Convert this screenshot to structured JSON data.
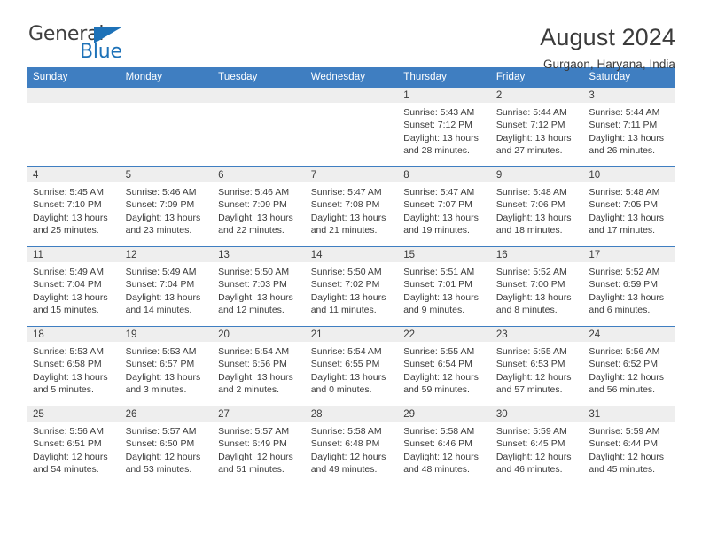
{
  "logo": {
    "word_one": "General",
    "word_two": "Blue",
    "triangle_icon": "triangle-icon",
    "accent_color": "#1e72b8"
  },
  "header": {
    "title": "August 2024",
    "subtitle": "Gurgaon, Haryana, India"
  },
  "calendar": {
    "header_color": "#3f7ec1",
    "weekday_headers": [
      "Sunday",
      "Monday",
      "Tuesday",
      "Wednesday",
      "Thursday",
      "Friday",
      "Saturday"
    ],
    "weeks": [
      [
        {
          "day": "",
          "sunrise": "",
          "sunset": "",
          "daylight_line1": "",
          "daylight_line2": ""
        },
        {
          "day": "",
          "sunrise": "",
          "sunset": "",
          "daylight_line1": "",
          "daylight_line2": ""
        },
        {
          "day": "",
          "sunrise": "",
          "sunset": "",
          "daylight_line1": "",
          "daylight_line2": ""
        },
        {
          "day": "",
          "sunrise": "",
          "sunset": "",
          "daylight_line1": "",
          "daylight_line2": ""
        },
        {
          "day": "1",
          "sunrise": "Sunrise: 5:43 AM",
          "sunset": "Sunset: 7:12 PM",
          "daylight_line1": "Daylight: 13 hours",
          "daylight_line2": "and 28 minutes."
        },
        {
          "day": "2",
          "sunrise": "Sunrise: 5:44 AM",
          "sunset": "Sunset: 7:12 PM",
          "daylight_line1": "Daylight: 13 hours",
          "daylight_line2": "and 27 minutes."
        },
        {
          "day": "3",
          "sunrise": "Sunrise: 5:44 AM",
          "sunset": "Sunset: 7:11 PM",
          "daylight_line1": "Daylight: 13 hours",
          "daylight_line2": "and 26 minutes."
        }
      ],
      [
        {
          "day": "4",
          "sunrise": "Sunrise: 5:45 AM",
          "sunset": "Sunset: 7:10 PM",
          "daylight_line1": "Daylight: 13 hours",
          "daylight_line2": "and 25 minutes."
        },
        {
          "day": "5",
          "sunrise": "Sunrise: 5:46 AM",
          "sunset": "Sunset: 7:09 PM",
          "daylight_line1": "Daylight: 13 hours",
          "daylight_line2": "and 23 minutes."
        },
        {
          "day": "6",
          "sunrise": "Sunrise: 5:46 AM",
          "sunset": "Sunset: 7:09 PM",
          "daylight_line1": "Daylight: 13 hours",
          "daylight_line2": "and 22 minutes."
        },
        {
          "day": "7",
          "sunrise": "Sunrise: 5:47 AM",
          "sunset": "Sunset: 7:08 PM",
          "daylight_line1": "Daylight: 13 hours",
          "daylight_line2": "and 21 minutes."
        },
        {
          "day": "8",
          "sunrise": "Sunrise: 5:47 AM",
          "sunset": "Sunset: 7:07 PM",
          "daylight_line1": "Daylight: 13 hours",
          "daylight_line2": "and 19 minutes."
        },
        {
          "day": "9",
          "sunrise": "Sunrise: 5:48 AM",
          "sunset": "Sunset: 7:06 PM",
          "daylight_line1": "Daylight: 13 hours",
          "daylight_line2": "and 18 minutes."
        },
        {
          "day": "10",
          "sunrise": "Sunrise: 5:48 AM",
          "sunset": "Sunset: 7:05 PM",
          "daylight_line1": "Daylight: 13 hours",
          "daylight_line2": "and 17 minutes."
        }
      ],
      [
        {
          "day": "11",
          "sunrise": "Sunrise: 5:49 AM",
          "sunset": "Sunset: 7:04 PM",
          "daylight_line1": "Daylight: 13 hours",
          "daylight_line2": "and 15 minutes."
        },
        {
          "day": "12",
          "sunrise": "Sunrise: 5:49 AM",
          "sunset": "Sunset: 7:04 PM",
          "daylight_line1": "Daylight: 13 hours",
          "daylight_line2": "and 14 minutes."
        },
        {
          "day": "13",
          "sunrise": "Sunrise: 5:50 AM",
          "sunset": "Sunset: 7:03 PM",
          "daylight_line1": "Daylight: 13 hours",
          "daylight_line2": "and 12 minutes."
        },
        {
          "day": "14",
          "sunrise": "Sunrise: 5:50 AM",
          "sunset": "Sunset: 7:02 PM",
          "daylight_line1": "Daylight: 13 hours",
          "daylight_line2": "and 11 minutes."
        },
        {
          "day": "15",
          "sunrise": "Sunrise: 5:51 AM",
          "sunset": "Sunset: 7:01 PM",
          "daylight_line1": "Daylight: 13 hours",
          "daylight_line2": "and 9 minutes."
        },
        {
          "day": "16",
          "sunrise": "Sunrise: 5:52 AM",
          "sunset": "Sunset: 7:00 PM",
          "daylight_line1": "Daylight: 13 hours",
          "daylight_line2": "and 8 minutes."
        },
        {
          "day": "17",
          "sunrise": "Sunrise: 5:52 AM",
          "sunset": "Sunset: 6:59 PM",
          "daylight_line1": "Daylight: 13 hours",
          "daylight_line2": "and 6 minutes."
        }
      ],
      [
        {
          "day": "18",
          "sunrise": "Sunrise: 5:53 AM",
          "sunset": "Sunset: 6:58 PM",
          "daylight_line1": "Daylight: 13 hours",
          "daylight_line2": "and 5 minutes."
        },
        {
          "day": "19",
          "sunrise": "Sunrise: 5:53 AM",
          "sunset": "Sunset: 6:57 PM",
          "daylight_line1": "Daylight: 13 hours",
          "daylight_line2": "and 3 minutes."
        },
        {
          "day": "20",
          "sunrise": "Sunrise: 5:54 AM",
          "sunset": "Sunset: 6:56 PM",
          "daylight_line1": "Daylight: 13 hours",
          "daylight_line2": "and 2 minutes."
        },
        {
          "day": "21",
          "sunrise": "Sunrise: 5:54 AM",
          "sunset": "Sunset: 6:55 PM",
          "daylight_line1": "Daylight: 13 hours",
          "daylight_line2": "and 0 minutes."
        },
        {
          "day": "22",
          "sunrise": "Sunrise: 5:55 AM",
          "sunset": "Sunset: 6:54 PM",
          "daylight_line1": "Daylight: 12 hours",
          "daylight_line2": "and 59 minutes."
        },
        {
          "day": "23",
          "sunrise": "Sunrise: 5:55 AM",
          "sunset": "Sunset: 6:53 PM",
          "daylight_line1": "Daylight: 12 hours",
          "daylight_line2": "and 57 minutes."
        },
        {
          "day": "24",
          "sunrise": "Sunrise: 5:56 AM",
          "sunset": "Sunset: 6:52 PM",
          "daylight_line1": "Daylight: 12 hours",
          "daylight_line2": "and 56 minutes."
        }
      ],
      [
        {
          "day": "25",
          "sunrise": "Sunrise: 5:56 AM",
          "sunset": "Sunset: 6:51 PM",
          "daylight_line1": "Daylight: 12 hours",
          "daylight_line2": "and 54 minutes."
        },
        {
          "day": "26",
          "sunrise": "Sunrise: 5:57 AM",
          "sunset": "Sunset: 6:50 PM",
          "daylight_line1": "Daylight: 12 hours",
          "daylight_line2": "and 53 minutes."
        },
        {
          "day": "27",
          "sunrise": "Sunrise: 5:57 AM",
          "sunset": "Sunset: 6:49 PM",
          "daylight_line1": "Daylight: 12 hours",
          "daylight_line2": "and 51 minutes."
        },
        {
          "day": "28",
          "sunrise": "Sunrise: 5:58 AM",
          "sunset": "Sunset: 6:48 PM",
          "daylight_line1": "Daylight: 12 hours",
          "daylight_line2": "and 49 minutes."
        },
        {
          "day": "29",
          "sunrise": "Sunrise: 5:58 AM",
          "sunset": "Sunset: 6:46 PM",
          "daylight_line1": "Daylight: 12 hours",
          "daylight_line2": "and 48 minutes."
        },
        {
          "day": "30",
          "sunrise": "Sunrise: 5:59 AM",
          "sunset": "Sunset: 6:45 PM",
          "daylight_line1": "Daylight: 12 hours",
          "daylight_line2": "and 46 minutes."
        },
        {
          "day": "31",
          "sunrise": "Sunrise: 5:59 AM",
          "sunset": "Sunset: 6:44 PM",
          "daylight_line1": "Daylight: 12 hours",
          "daylight_line2": "and 45 minutes."
        }
      ]
    ]
  }
}
